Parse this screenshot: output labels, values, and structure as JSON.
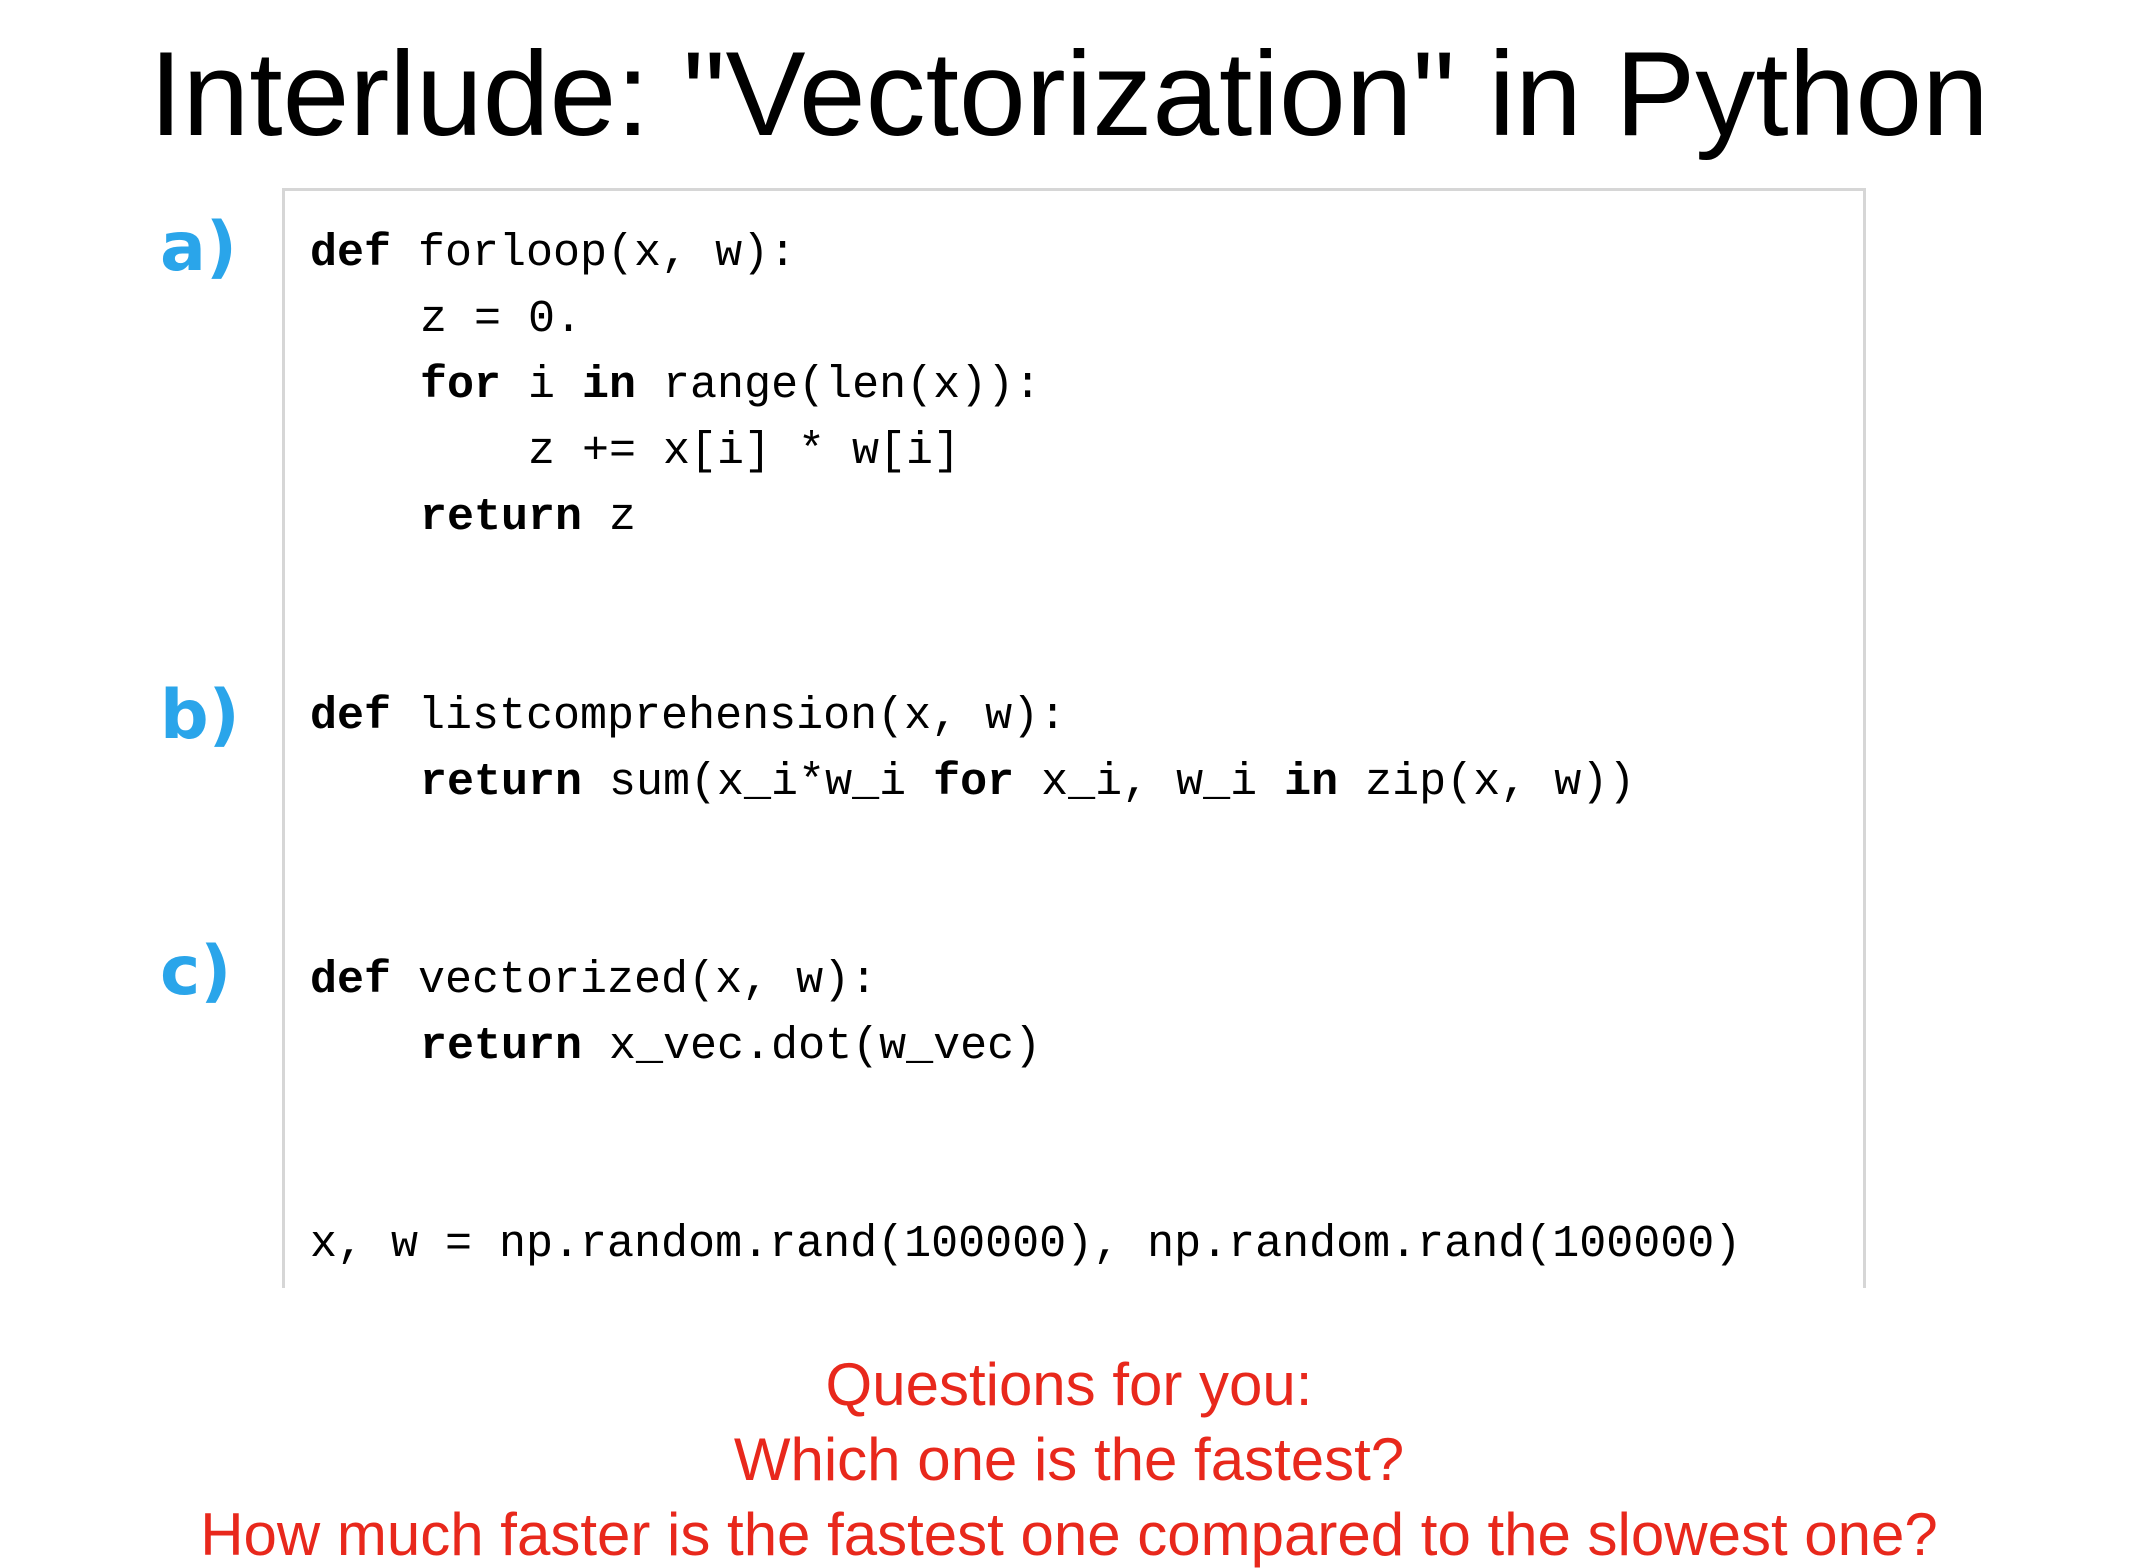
{
  "title": "Interlude: \"Vectorization\" in Python",
  "colors": {
    "label_accent": "#2aa5ea",
    "question_text": "#e8281c",
    "code_text": "#000000",
    "box_border": "#d6d6d6"
  },
  "labels": {
    "a": "a)",
    "b": "b)",
    "c": "c)"
  },
  "code": {
    "forloop": {
      "l1_kw": "def",
      "l1_rest": " forloop(x, w):",
      "l2": "z = 0.",
      "l3_kw1": "for",
      "l3_mid": " i ",
      "l3_kw2": "in",
      "l3_rest": " range(len(x)):",
      "l4": "z += x[i] * w[i]",
      "l5_kw": "return",
      "l5_rest": " z"
    },
    "listcomp": {
      "l1_kw": "def",
      "l1_rest": " listcomprehension(x, w):",
      "l2_kw1": "return",
      "l2_mid1": " sum(x_i*w_i ",
      "l2_kw2": "for",
      "l2_mid2": " x_i, w_i ",
      "l2_kw3": "in",
      "l2_rest": " zip(x, w))"
    },
    "vectorized": {
      "l1_kw": "def",
      "l1_rest": " vectorized(x, w):",
      "l2_kw": "return",
      "l2_rest": " x_vec.dot(w_vec)"
    },
    "setup": "x, w = np.random.rand(100000), np.random.rand(100000)"
  },
  "questions": {
    "q1": "Questions for you:",
    "q2": "Which one is the fastest?",
    "q3": "How much faster is the fastest one compared to the slowest one?"
  }
}
